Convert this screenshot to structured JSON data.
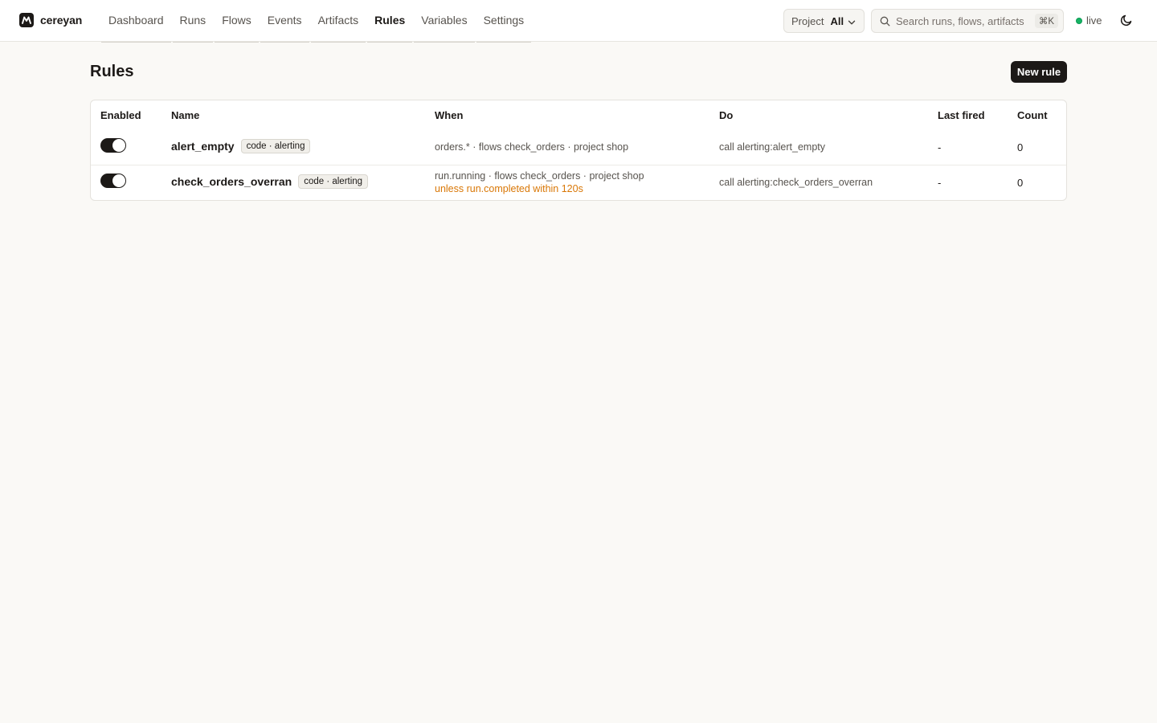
{
  "brand": {
    "name": "cereyan"
  },
  "nav": [
    {
      "label": "Dashboard"
    },
    {
      "label": "Runs"
    },
    {
      "label": "Flows"
    },
    {
      "label": "Events"
    },
    {
      "label": "Artifacts"
    },
    {
      "label": "Rules",
      "active": true
    },
    {
      "label": "Variables"
    },
    {
      "label": "Settings"
    }
  ],
  "project_select": {
    "label": "Project",
    "value": "All"
  },
  "search": {
    "placeholder": "Search runs, flows, artifacts",
    "shortcut": "⌘K"
  },
  "status": {
    "label": "live",
    "color": "#16b364"
  },
  "page": {
    "title": "Rules",
    "new_rule_label": "New rule"
  },
  "table": {
    "columns": [
      "Enabled",
      "Name",
      "When",
      "Do",
      "Last fired",
      "Count"
    ],
    "rows": [
      {
        "enabled": true,
        "name": "alert_empty",
        "badge": "code · alerting",
        "when": "orders.* · flows check_orders · project shop",
        "when_unless": "",
        "do": "call alerting:alert_empty",
        "last_fired": "-",
        "count": "0"
      },
      {
        "enabled": true,
        "name": "check_orders_overran",
        "badge": "code · alerting",
        "when": "run.running · flows check_orders · project shop",
        "when_unless": "unless run.completed within 120s",
        "do": "call alerting:check_orders_overran",
        "last_fired": "-",
        "count": "0"
      }
    ]
  },
  "colors": {
    "accent": "#1c1917",
    "background": "#faf9f6",
    "warning": "#d97706"
  }
}
